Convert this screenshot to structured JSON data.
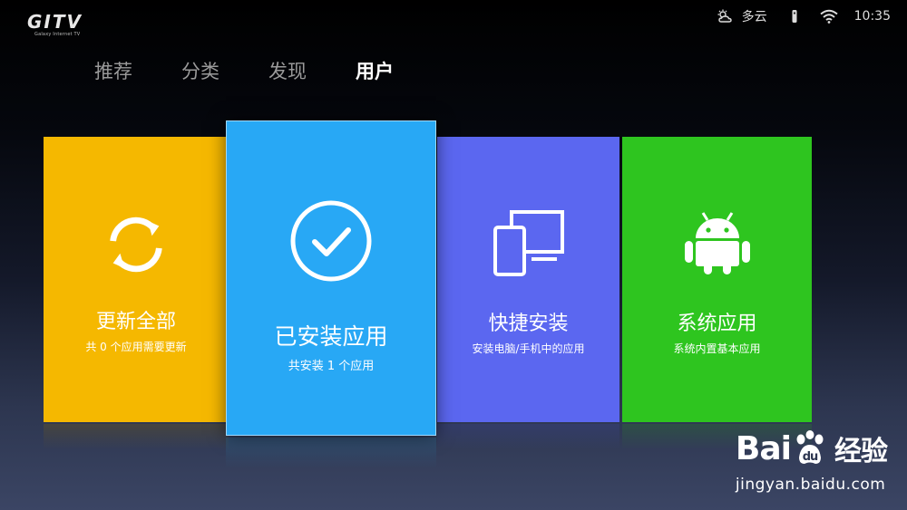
{
  "logo": {
    "word": "GITV",
    "sub": "Galaxy Internet TV"
  },
  "status": {
    "weather": "多云",
    "time": "10:35"
  },
  "nav": {
    "tabs": [
      {
        "label": "推荐"
      },
      {
        "label": "分类"
      },
      {
        "label": "发现"
      },
      {
        "label": "用户"
      }
    ]
  },
  "cards": [
    {
      "title": "更新全部",
      "subtitle": "共 0 个应用需要更新",
      "color": "#f5b800",
      "icon": "refresh-icon"
    },
    {
      "title": "已安装应用",
      "subtitle": "共安装 1 个应用",
      "color": "#28a8f5",
      "icon": "check-circle-icon"
    },
    {
      "title": "快捷安装",
      "subtitle": "安装电脑/手机中的应用",
      "color": "#5b67f0",
      "icon": "devices-icon"
    },
    {
      "title": "系统应用",
      "subtitle": "系统内置基本应用",
      "color": "#2ec51f",
      "icon": "android-icon"
    }
  ],
  "watermark": {
    "brand_a": "Bai",
    "brand_b": "du",
    "brand_c": "经验",
    "url": "jingyan.baidu.com"
  }
}
